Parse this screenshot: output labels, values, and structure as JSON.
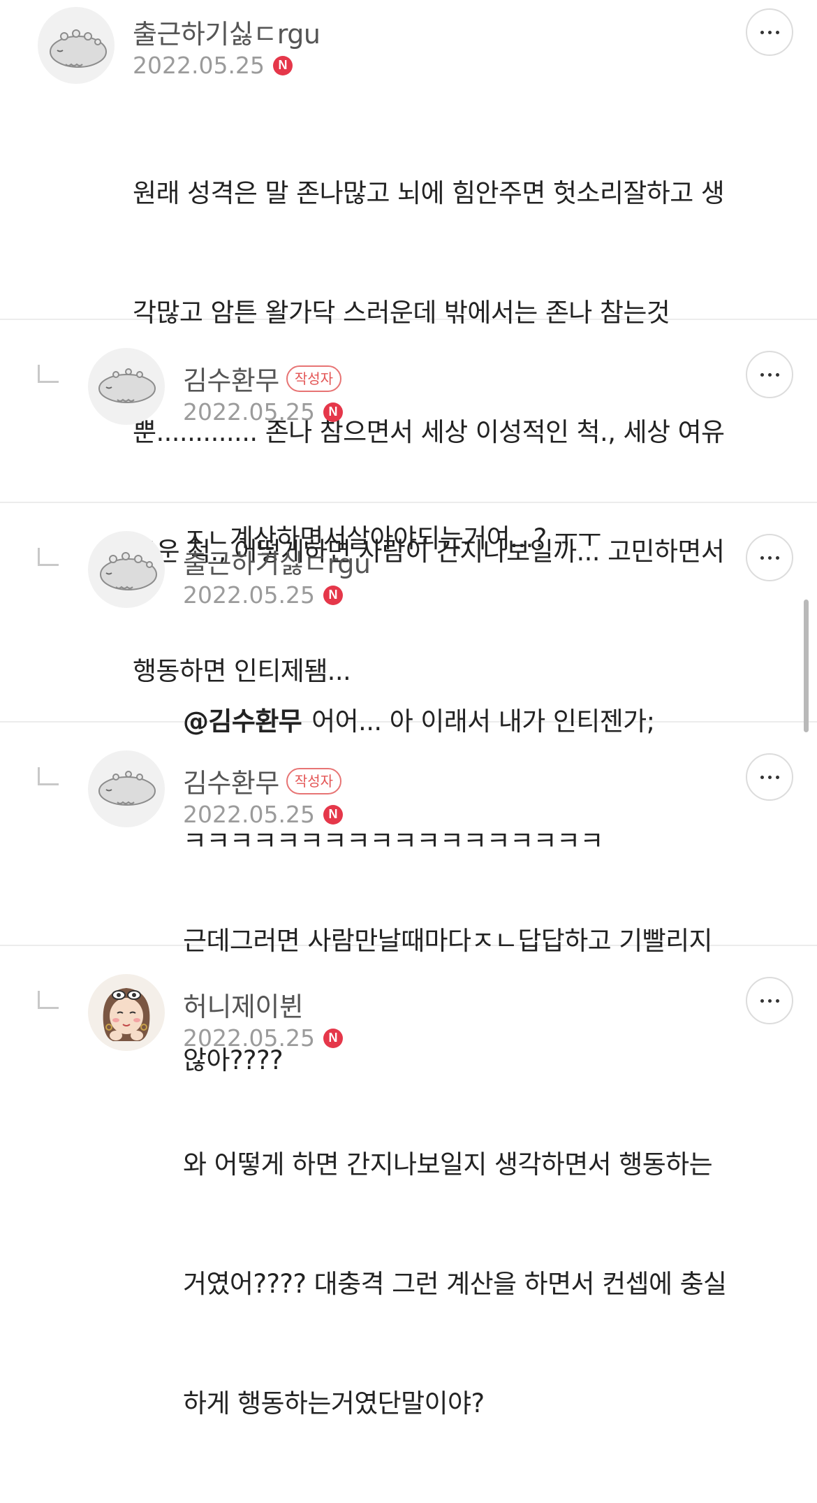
{
  "comments": [
    {
      "nickname": "출근하기싫ㄷrgu",
      "date": "2022.05.25",
      "new_badge": "N",
      "is_reply": false,
      "is_author": false,
      "avatar": "gray-creature",
      "lines": [
        "원래 성격은 말 존나많고 뇌에 힘안주면 헛소리잘하고 생",
        "각많고 암튼 왈가닥 스러운데 밖에서는 존나 참는것",
        "뿐............. 존나 참으면서 세상 이성적인 척., 세상 여유",
        "로운 척., 어떻게하면 사람이 간지나보일까... 고민하면서",
        "행동하면 인티제됌..."
      ]
    },
    {
      "nickname": "김수환무",
      "author_badge": "작성자",
      "date": "2022.05.25",
      "new_badge": "N",
      "is_reply": true,
      "is_author": true,
      "avatar": "gray-creature",
      "lines": [
        "ㅈㄴ계산하면서살아야되는거여...? ㅜㅜ"
      ]
    },
    {
      "nickname": "출근하기싫ㄷrgu",
      "date": "2022.05.25",
      "new_badge": "N",
      "is_reply": true,
      "is_author": false,
      "avatar": "gray-creature",
      "mention": "@김수환무",
      "lines": [
        "어어... 아 이래서 내가 인티젠가;",
        "ㅋㅋㅋㅋㅋㅋㅋㅋㅋㅋㅋㅋㅋㅋㅋㅋㅋㅋ"
      ]
    },
    {
      "nickname": "김수환무",
      "author_badge": "작성자",
      "date": "2022.05.25",
      "new_badge": "N",
      "is_reply": true,
      "is_author": true,
      "avatar": "gray-creature",
      "lines": [
        "근데그러면 사람만날때마다ㅈㄴ답답하고 기빨리지",
        "않아????"
      ]
    },
    {
      "nickname": "허니제이뷘",
      "date": "2022.05.25",
      "new_badge": "N",
      "is_reply": true,
      "is_author": false,
      "avatar": "girl-character",
      "lines": [
        "와 어떻게 하면 간지나보일지 생각하면서 행동하는",
        "거였어???? 대충격 그런 계산을 하면서 컨셉에 충실",
        "하게 행동하는거였단말이야?"
      ]
    }
  ]
}
